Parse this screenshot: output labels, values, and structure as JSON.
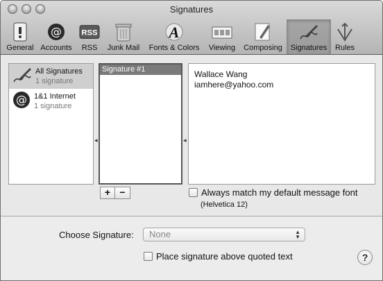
{
  "window": {
    "title": "Signatures"
  },
  "toolbar": {
    "items": [
      {
        "label": "General",
        "icon": "general-switch-icon"
      },
      {
        "label": "Accounts",
        "icon": "at-sign-icon"
      },
      {
        "label": "RSS",
        "icon": "rss-icon"
      },
      {
        "label": "Junk Mail",
        "icon": "trash-can-icon"
      },
      {
        "label": "Fonts & Colors",
        "icon": "font-a-icon"
      },
      {
        "label": "Viewing",
        "icon": "viewing-icon"
      },
      {
        "label": "Composing",
        "icon": "composing-pencil-icon"
      },
      {
        "label": "Signatures",
        "icon": "signature-pen-icon",
        "selected": true
      },
      {
        "label": "Rules",
        "icon": "rules-arrows-icon"
      }
    ]
  },
  "accounts": [
    {
      "name": "All Signatures",
      "count": "1 signature",
      "icon": "signature-pen-icon",
      "selected": true
    },
    {
      "name": "1&1 Internet",
      "count": "1 signature",
      "icon": "at-sign-icon",
      "selected": false
    }
  ],
  "signatures": [
    {
      "name": "Signature #1",
      "selected": true
    }
  ],
  "signature_text": {
    "line1": "Wallace Wang",
    "line2": "iamhere@yahoo.com"
  },
  "buttons": {
    "add": "+",
    "remove": "−"
  },
  "match_font": {
    "label": "Always match my default message font",
    "sub": "(Helvetica 12)",
    "checked": false
  },
  "choose_signature": {
    "label": "Choose Signature:",
    "value": "None"
  },
  "place_above": {
    "label": "Place signature above quoted text",
    "checked": false
  },
  "help": {
    "label": "?"
  }
}
